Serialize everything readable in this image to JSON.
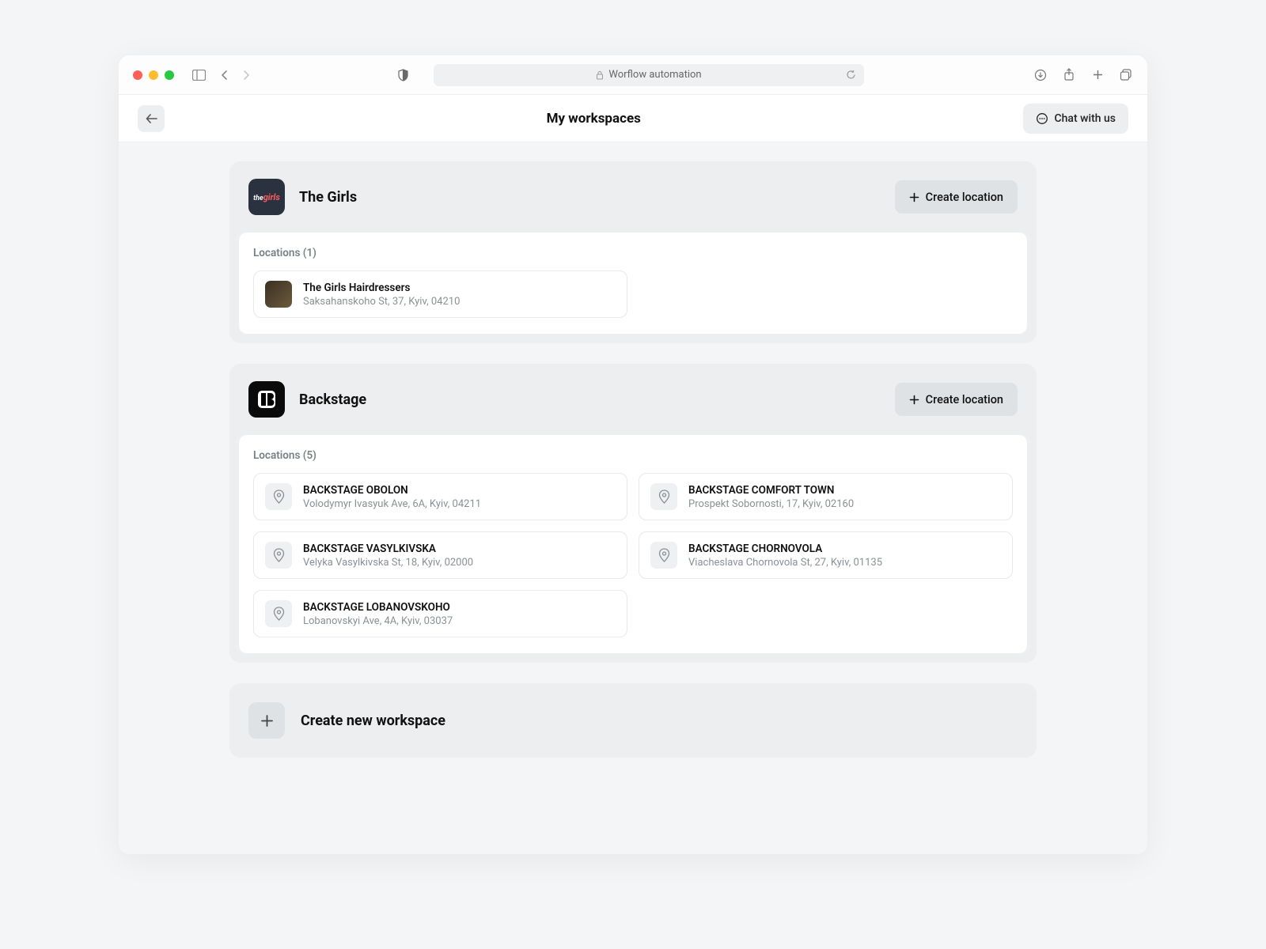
{
  "browser": {
    "url_label": "Worflow automation"
  },
  "header": {
    "title": "My workspaces",
    "chat_label": "Chat with us"
  },
  "workspaces": [
    {
      "name": "The Girls",
      "create_location_label": "Create location",
      "locations_label": "Locations (1)",
      "locations": [
        {
          "name": "The Girls Hairdressers",
          "address": "Saksahanskoho St, 37, Kyiv, 04210"
        }
      ]
    },
    {
      "name": "Backstage",
      "create_location_label": "Create location",
      "locations_label": "Locations (5)",
      "locations": [
        {
          "name": "BACKSTAGE OBOLON",
          "address": "Volodymyr Ivasyuk Ave, 6A, Kyiv, 04211"
        },
        {
          "name": "BACKSTAGE COMFORT TOWN",
          "address": "Prospekt Sobornosti, 17, Kyiv, 02160"
        },
        {
          "name": "BACKSTAGE VASYLKIVSKA",
          "address": "Velyka Vasylkivska St, 18, Kyiv, 02000"
        },
        {
          "name": "BACKSTAGE CHORNOVOLA",
          "address": "Viacheslava Chornovola St, 27, Kyiv, 01135"
        },
        {
          "name": "BACKSTAGE LOBANOVSKOHO",
          "address": "Lobanovskyi Ave, 4A, Kyiv, 03037"
        }
      ]
    }
  ],
  "create_workspace_label": "Create new workspace"
}
